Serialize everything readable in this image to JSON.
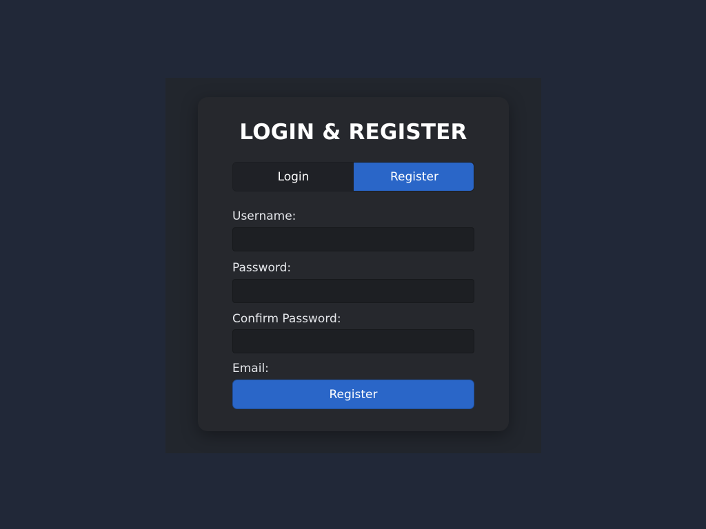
{
  "form": {
    "title": "LOGIN & REGISTER",
    "tabs": [
      {
        "label": "Login",
        "active": false
      },
      {
        "label": "Register",
        "active": true
      }
    ],
    "fields": {
      "username": {
        "label": "Username:",
        "value": ""
      },
      "password": {
        "label": "Password:",
        "value": ""
      },
      "confirm_password": {
        "label": "Confirm Password:",
        "value": ""
      },
      "email": {
        "label": "Email:"
      }
    },
    "submit_label": "Register"
  },
  "colors": {
    "page_background": "#212838",
    "card_background": "#26282d",
    "accent": "#2a66c8",
    "input_background": "#1d1f23",
    "text": "#ffffff"
  }
}
